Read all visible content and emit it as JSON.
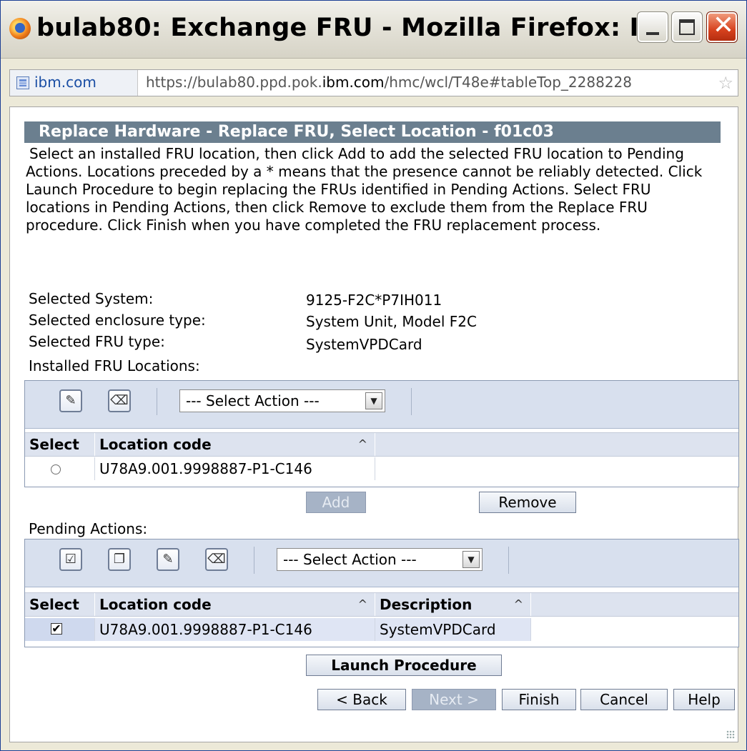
{
  "window": {
    "title": "bulab80: Exchange FRU - Mozilla Firefox: I..."
  },
  "urlbar": {
    "site": "ibm.com",
    "url_prefix": "https://bulab80.ppd.pok.",
    "url_domain": "ibm.com",
    "url_suffix": "/hmc/wcl/T48e#tableTop_2288228"
  },
  "page": {
    "title": "Replace Hardware - Replace FRU, Select Location - f01c03",
    "instructions": "Select an installed FRU location, then click Add to add the selected FRU location to Pending Actions. Locations preceded by a * means that the presence cannot be reliably detected. Click Launch Procedure to begin replacing the FRUs identified in Pending Actions. Select FRU locations in Pending Actions, then click Remove to exclude them from the Replace FRU procedure. Click Finish when you have completed the FRU replacement process.",
    "selected_system_label": "Selected System:",
    "selected_system_value": "9125-F2C*P7IH011",
    "enclosure_label": "Selected enclosure type:",
    "enclosure_value": "System Unit, Model F2C",
    "fru_type_label": "Selected FRU type:",
    "fru_type_value": "SystemVPDCard",
    "installed_label": "Installed FRU Locations:",
    "pending_label": "Pending Actions:"
  },
  "installed_table": {
    "select_action": "--- Select Action ---",
    "col_select": "Select",
    "col_location": "Location code",
    "rows": [
      {
        "location": "U78A9.001.9998887-P1-C146"
      }
    ]
  },
  "installed_buttons": {
    "add": "Add",
    "remove": "Remove"
  },
  "pending_table": {
    "select_action": "--- Select Action ---",
    "col_select": "Select",
    "col_location": "Location code",
    "col_description": "Description",
    "rows": [
      {
        "location": "U78A9.001.9998887-P1-C146",
        "description": "SystemVPDCard",
        "checked": true
      }
    ]
  },
  "buttons": {
    "launch": "Launch Procedure",
    "back": "< Back",
    "next": "Next >",
    "finish": "Finish",
    "cancel": "Cancel",
    "help": "Help"
  },
  "glyphs": {
    "sort": "^",
    "checkmark": "✔",
    "close": "✕",
    "star": "☆",
    "dropdown": "▼"
  }
}
